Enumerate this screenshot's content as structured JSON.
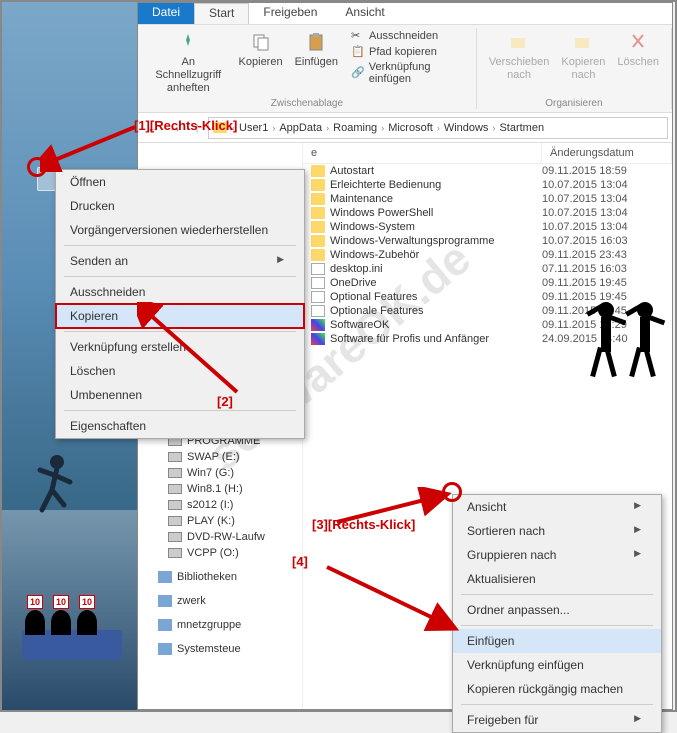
{
  "tabs": {
    "file": "Datei",
    "start": "Start",
    "share": "Freigeben",
    "view": "Ansicht"
  },
  "ribbon": {
    "pin": "An Schnellzugriff\nanheften",
    "copy": "Kopieren",
    "paste": "Einfügen",
    "cut": "Ausschneiden",
    "copypath": "Pfad kopieren",
    "pastelink": "Verknüpfung einfügen",
    "clipboard_label": "Zwischenablage",
    "moveto": "Verschieben\nnach",
    "copyto": "Kopieren\nnach",
    "delete": "Löschen",
    "organize_label": "Organisieren"
  },
  "breadcrumbs": [
    "User1",
    "AppData",
    "Roaming",
    "Microsoft",
    "Windows",
    "Startmen"
  ],
  "list_header": {
    "name": "e",
    "date": "Änderungsdatum"
  },
  "files": [
    {
      "name": "Autostart",
      "date": "09.11.2015 18:59",
      "type": "folder"
    },
    {
      "name": "Erleichterte Bedienung",
      "date": "10.07.2015 13:04",
      "type": "folder"
    },
    {
      "name": "Maintenance",
      "date": "10.07.2015 13:04",
      "type": "folder"
    },
    {
      "name": "Windows PowerShell",
      "date": "10.07.2015 13:04",
      "type": "folder"
    },
    {
      "name": "Windows-System",
      "date": "10.07.2015 13:04",
      "type": "folder"
    },
    {
      "name": "Windows-Verwaltungsprogramme",
      "date": "10.07.2015 16:03",
      "type": "folder"
    },
    {
      "name": "Windows-Zubehör",
      "date": "09.11.2015 23:43",
      "type": "folder"
    },
    {
      "name": "desktop.ini",
      "date": "07.11.2015 16:03",
      "type": "file"
    },
    {
      "name": "OneDrive",
      "date": "09.11.2015 19:45",
      "type": "link"
    },
    {
      "name": "Optional Features",
      "date": "09.11.2015 19:45",
      "type": "link"
    },
    {
      "name": "Optionale Features",
      "date": "09.11.2015 19:45",
      "type": "link"
    },
    {
      "name": "SoftwareOK",
      "date": "09.11.2015 18:29",
      "type": "app"
    },
    {
      "name": "Software für Profis und Anfänger",
      "date": "24.09.2015 14:40",
      "type": "app"
    }
  ],
  "sidebar": [
    "PROGRAMME",
    "SWAP (E:)",
    "Win7 (G:)",
    "Win8.1 (H:)",
    "s2012 (I:)",
    "PLAY (K:)",
    "DVD-RW-Laufw",
    "VCPP (O:)"
  ],
  "sidebar_extra": [
    "Bibliotheken",
    "zwerk",
    "mnetzgruppe",
    "Systemsteue"
  ],
  "ctx1": {
    "open": "Öffnen",
    "print": "Drucken",
    "restore": "Vorgängerversionen wiederherstellen",
    "sendto": "Senden an",
    "cut": "Ausschneiden",
    "copy": "Kopieren",
    "shortcut": "Verknüpfung erstellen",
    "delete": "Löschen",
    "rename": "Umbenennen",
    "props": "Eigenschaften"
  },
  "ctx2": {
    "view": "Ansicht",
    "sort": "Sortieren nach",
    "group": "Gruppieren nach",
    "refresh": "Aktualisieren",
    "customize": "Ordner anpassen...",
    "paste": "Einfügen",
    "pastelink": "Verknüpfung einfügen",
    "undo": "Kopieren rückgängig machen",
    "share": "Freigeben für"
  },
  "annotations": {
    "a1": "[1][Rechts-Klick]",
    "a2": "[2]",
    "a3": "[3][Rechts-Klick]",
    "a4": "[4]"
  },
  "watermark": "softwareOK.de",
  "judge_score": "10"
}
